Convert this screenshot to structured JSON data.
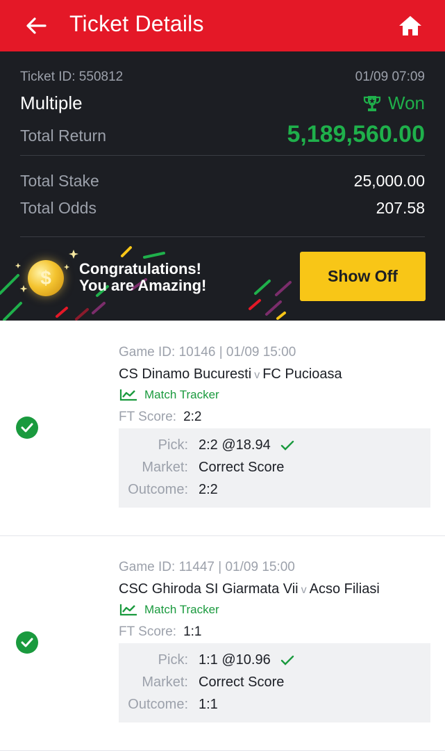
{
  "header": {
    "title": "Ticket Details"
  },
  "ticket": {
    "id_label": "Ticket ID: 550812",
    "datetime": "01/09 07:09",
    "type": "Multiple",
    "status": "Won",
    "total_return_label": "Total Return",
    "total_return": "5,189,560.00",
    "total_stake_label": "Total Stake",
    "total_stake": "25,000.00",
    "total_odds_label": "Total Odds",
    "total_odds": "207.58"
  },
  "banner": {
    "line1": "Congratulations!",
    "line2": "You are Amazing!",
    "coin_symbol": "$",
    "button_label": "Show Off"
  },
  "games": [
    {
      "game_id": "Game ID: 10146 | 01/09 15:00",
      "home": "CS Dinamo Bucuresti",
      "vs": "v",
      "away": "FC Pucioasa",
      "tracker_label": "Match Tracker",
      "ft_label": "FT Score:",
      "ft_score": "2:2",
      "pick_label": "Pick:",
      "pick": "2:2 @18.94",
      "market_label": "Market:",
      "market": "Correct Score",
      "outcome_label": "Outcome:",
      "outcome": "2:2"
    },
    {
      "game_id": "Game ID: 11447 | 01/09 15:00",
      "home": "CSC Ghiroda SI Giarmata Vii",
      "vs": "v",
      "away": "Acso Filiasi",
      "tracker_label": "Match Tracker",
      "ft_label": "FT Score:",
      "ft_score": "1:1",
      "pick_label": "Pick:",
      "pick": "1:1 @10.96",
      "market_label": "Market:",
      "market": "Correct Score",
      "outcome_label": "Outcome:",
      "outcome": "1:1"
    }
  ],
  "colors": {
    "header_red": "#e41827",
    "dark_panel": "#1c1e23",
    "win_green": "#1fb04b",
    "button_yellow": "#f8c617"
  },
  "icons": [
    "back-arrow-icon",
    "home-icon",
    "trophy-icon",
    "coin-icon",
    "check-circle-icon",
    "chart-line-icon",
    "checkmark-icon"
  ]
}
